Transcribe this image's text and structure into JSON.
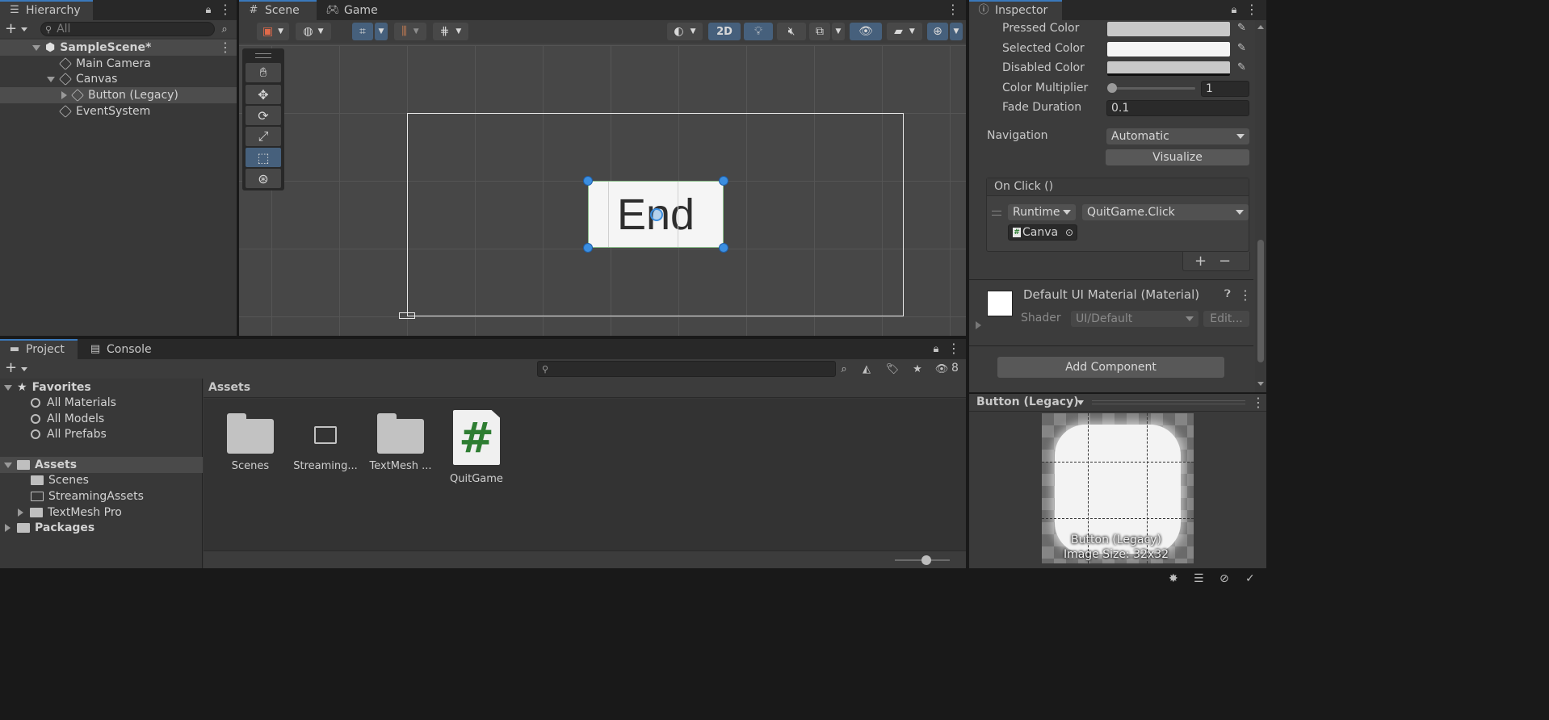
{
  "hierarchy": {
    "tab_label": "Hierarchy",
    "search_placeholder": "All",
    "items": [
      {
        "label": "SampleScene*"
      },
      {
        "label": "Main Camera"
      },
      {
        "label": "Canvas"
      },
      {
        "label": "Button (Legacy)"
      },
      {
        "label": "EventSystem"
      }
    ]
  },
  "scene": {
    "tabs": [
      {
        "label": "Scene"
      },
      {
        "label": "Game"
      }
    ],
    "toolbar": {
      "mode_2d_label": "2D"
    },
    "button_text": "End"
  },
  "inspector": {
    "tab_label": "Inspector",
    "rows": {
      "pressed_color_label": "Pressed Color",
      "selected_color_label": "Selected Color",
      "disabled_color_label": "Disabled Color",
      "color_multiplier_label": "Color Multiplier",
      "color_multiplier_value": "1",
      "fade_duration_label": "Fade Duration",
      "fade_duration_value": "0.1",
      "navigation_label": "Navigation",
      "navigation_value": "Automatic",
      "visualize_label": "Visualize"
    },
    "onclick": {
      "title": "On Click ()",
      "runtime_value": "Runtime",
      "function_value": "QuitGame.Click",
      "target_value": "Canva",
      "add_label": "+",
      "remove_label": "−"
    },
    "material": {
      "title": "Default UI Material (Material)",
      "shader_label": "Shader",
      "shader_value": "UI/Default",
      "edit_label": "Edit..."
    },
    "add_component_label": "Add Component",
    "preview": {
      "title": "Button (Legacy)",
      "caption_name": "Button (Legacy)",
      "caption_size": "Image Size: 32x32"
    }
  },
  "project": {
    "tabs": [
      {
        "label": "Project"
      },
      {
        "label": "Console"
      }
    ],
    "hidden_count": "8",
    "tree": {
      "favorites_label": "Favorites",
      "favorites": [
        {
          "label": "All Materials"
        },
        {
          "label": "All Models"
        },
        {
          "label": "All Prefabs"
        }
      ],
      "assets_label": "Assets",
      "assets": [
        {
          "label": "Scenes"
        },
        {
          "label": "StreamingAssets"
        },
        {
          "label": "TextMesh Pro"
        }
      ],
      "packages_label": "Packages"
    },
    "breadcrumb": "Assets",
    "grid": [
      {
        "label": "Scenes"
      },
      {
        "label": "Streaming..."
      },
      {
        "label": "TextMesh ..."
      },
      {
        "label": "QuitGame"
      }
    ]
  },
  "colors": {
    "accent": "#3a79bb",
    "selection": "#46607c",
    "panel": "#383838",
    "script_green": "#2e7d32"
  }
}
